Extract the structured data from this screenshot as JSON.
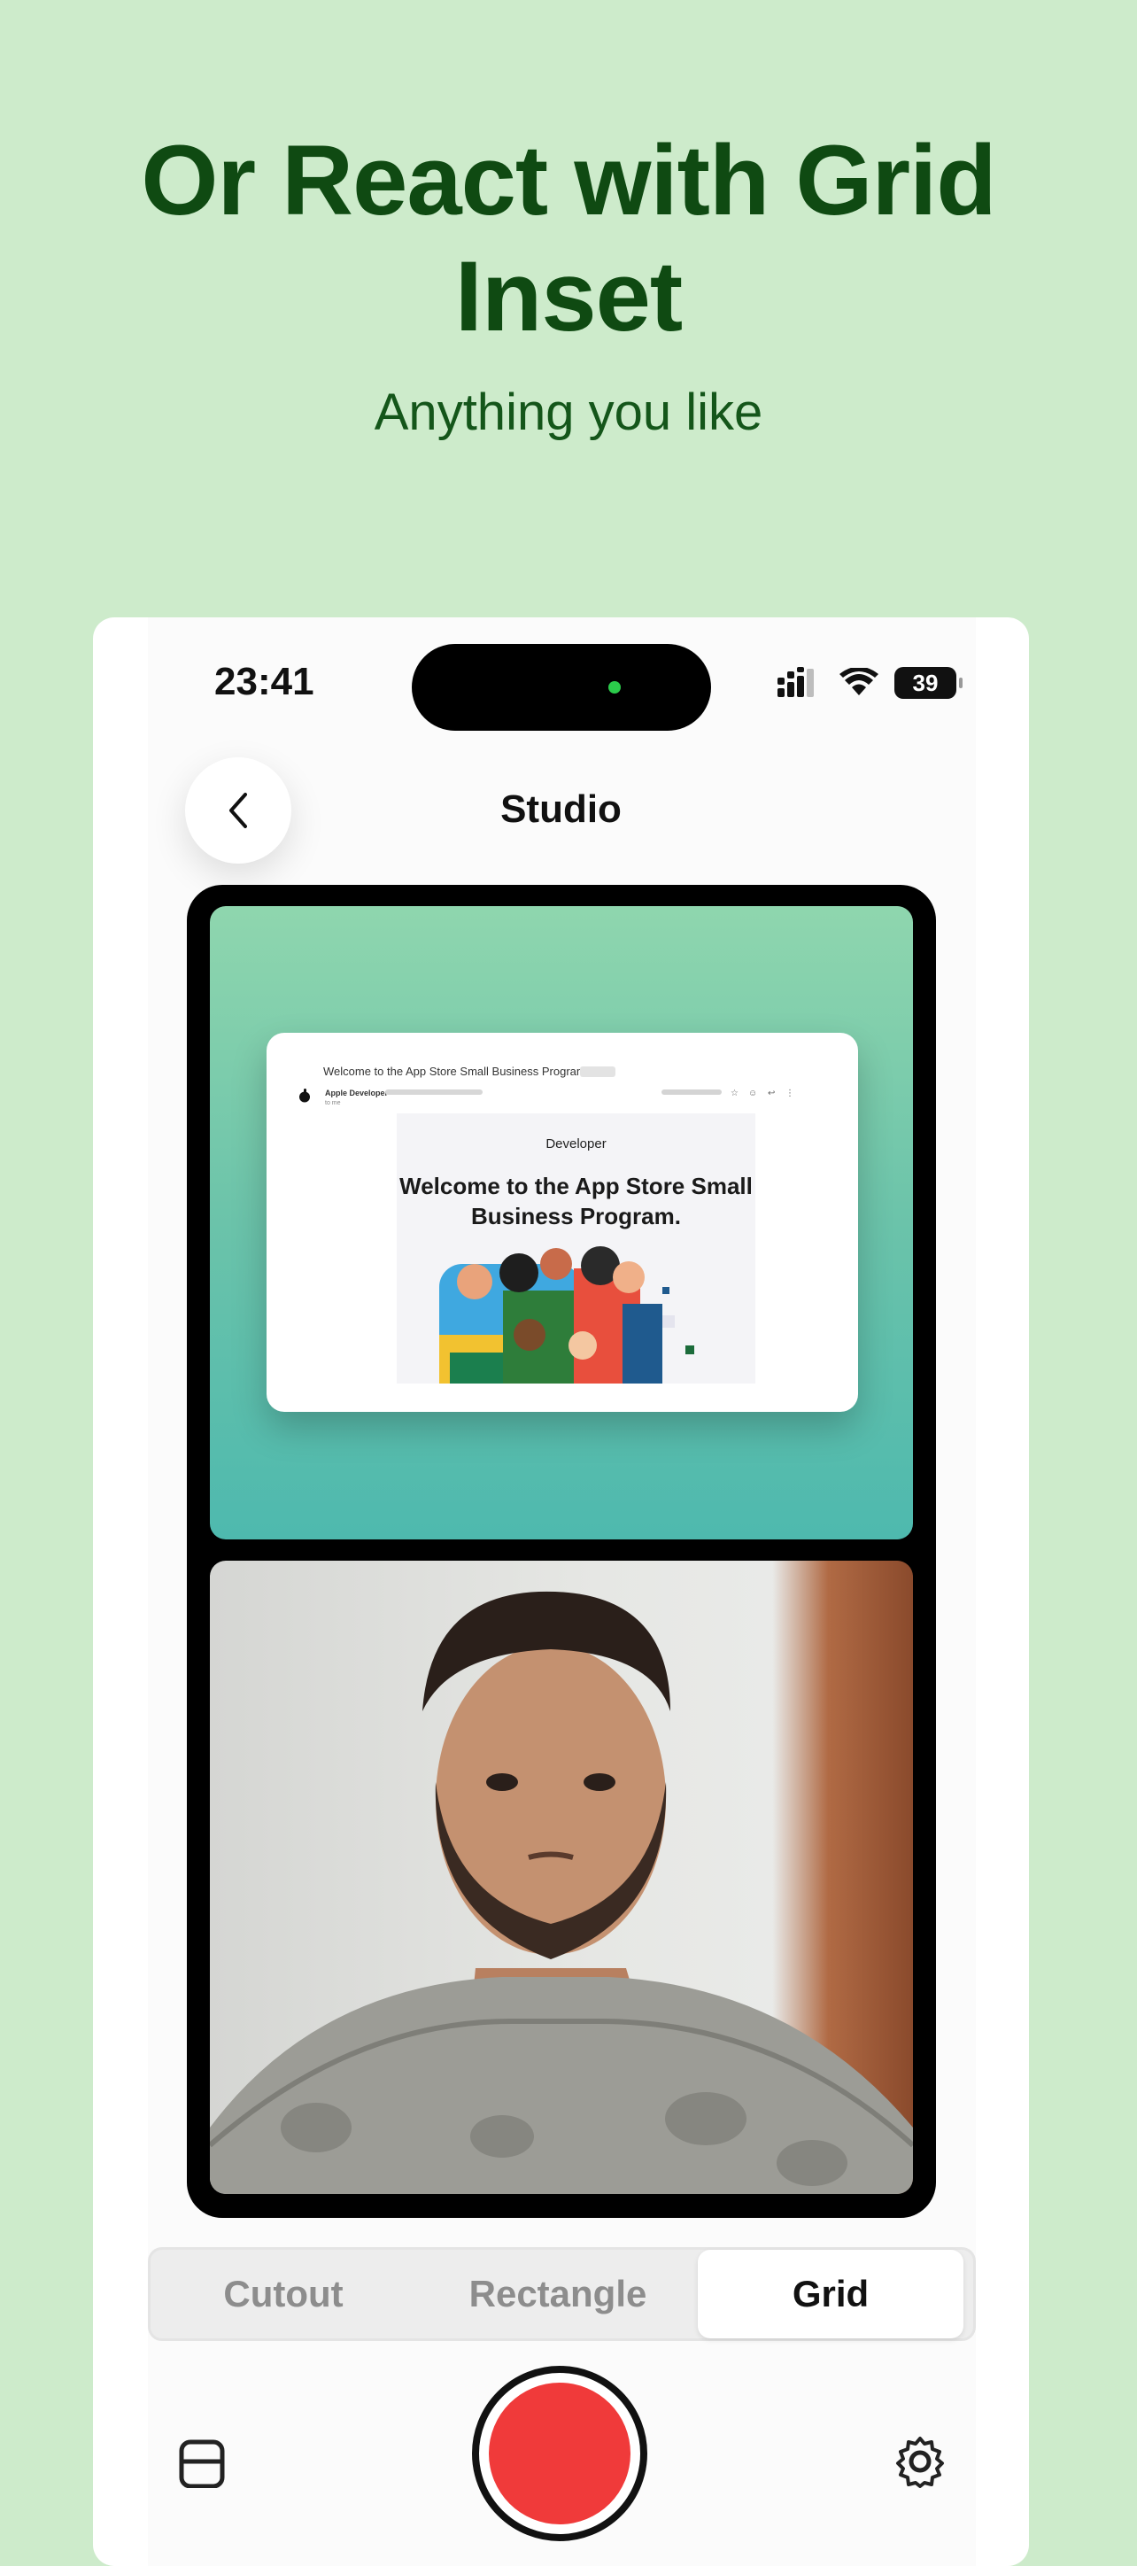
{
  "headline": {
    "line1": "Or React with Grid",
    "line2": "Inset"
  },
  "subheadline": "Anything you like",
  "status_bar": {
    "time": "23:41",
    "battery": "39"
  },
  "nav": {
    "title": "Studio"
  },
  "email_preview": {
    "subject": "Welcome to the App Store Small Business Program.",
    "sender": "Apple Developer",
    "to_line": "to me",
    "brand": "Developer",
    "headline": "Welcome to the App Store Small Business Program."
  },
  "layout_modes": {
    "options": [
      "Cutout",
      "Rectangle",
      "Grid"
    ],
    "selected": "Grid"
  },
  "colors": {
    "background": "#CDEBCB",
    "headline": "#0F4A12",
    "record": "#F03A3A",
    "island_indicator": "#2BCB4B"
  },
  "icons": {
    "back": "chevron-left-icon",
    "cellular": "cellular-signal-icon",
    "wifi": "wifi-icon",
    "library": "media-library-icon",
    "settings": "gear-icon"
  }
}
